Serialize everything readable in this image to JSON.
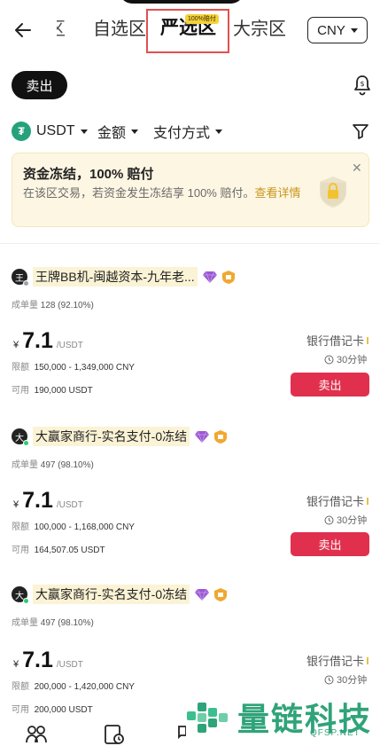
{
  "header": {
    "tabs": [
      {
        "label": "区",
        "state": "partial"
      },
      {
        "label": "自选区",
        "state": "normal"
      },
      {
        "label": "严选区",
        "state": "active"
      },
      {
        "label": "大宗区",
        "state": "normal"
      }
    ],
    "active_badge": "100%赔付",
    "currency": "CNY"
  },
  "mode": {
    "sell_label": "卖出"
  },
  "filters": {
    "coin": "USDT",
    "amount": "金额",
    "payment": "支付方式"
  },
  "notice": {
    "title": "资金冻结，100% 赔付",
    "text": "在该区交易，若资金发生冻结享 100% 赔付。",
    "link": "查看详情"
  },
  "listings": [
    {
      "avatar": "王",
      "avatar_dot_color": "#9aa3b0",
      "name": "王牌BB机-闽越资本-九年老...",
      "stat_label": "成单量",
      "stat_value": "128 (92.10%)",
      "currency_symbol": "¥",
      "price": "7.1",
      "price_unit": "/USDT",
      "limit_label": "限额",
      "limit_value": "150,000 - 1,349,000 CNY",
      "available_label": "可用",
      "available_value": "190,000 USDT",
      "payment": "银行借记卡",
      "timer": "30分钟",
      "button": "卖出"
    },
    {
      "avatar": "大",
      "avatar_dot_color": "#2ecc71",
      "name": "大赢家商行-实名支付-0冻结",
      "stat_label": "成单量",
      "stat_value": "497 (98.10%)",
      "currency_symbol": "¥",
      "price": "7.1",
      "price_unit": "/USDT",
      "limit_label": "限额",
      "limit_value": "100,000 - 1,168,000 CNY",
      "available_label": "可用",
      "available_value": "164,507.05 USDT",
      "payment": "银行借记卡",
      "timer": "30分钟",
      "button": "卖出"
    },
    {
      "avatar": "大",
      "avatar_dot_color": "#2ecc71",
      "name": "大赢家商行-实名支付-0冻结",
      "stat_label": "成单量",
      "stat_value": "497 (98.10%)",
      "currency_symbol": "¥",
      "price": "7.1",
      "price_unit": "/USDT",
      "limit_label": "限额",
      "limit_value": "200,000 - 1,420,000 CNY",
      "available_label": "可用",
      "available_value": "200,000 USDT",
      "payment": "银行借记卡",
      "timer": "30分钟",
      "button": "卖出"
    }
  ],
  "bottom_nav": [
    "people-icon",
    "orders-icon",
    "chat-icon"
  ],
  "watermark": {
    "name": "量链科技",
    "url": "QFSP.NET"
  },
  "colors": {
    "sell": "#e0304e",
    "notice_bg": "#fdf6e3",
    "badge": "#f4d23a",
    "watermark": "#2fa37a"
  }
}
